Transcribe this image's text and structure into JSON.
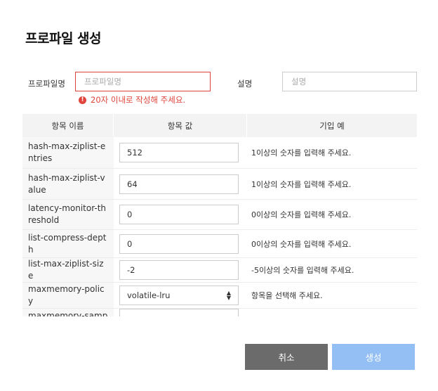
{
  "dialog": {
    "title": "프로파일 생성"
  },
  "form": {
    "name_label": "프로파일명",
    "name_placeholder": "프로파일명",
    "name_error": "20자 이내로 작성해 주세요.",
    "desc_label": "설명",
    "desc_placeholder": "설명"
  },
  "table": {
    "columns": [
      "항목 이름",
      "항목 값",
      "기입 예"
    ],
    "rows": [
      {
        "name": "hash-max-ziplist-entries",
        "value": "512",
        "hint": "1이상의 숫자를 입력해 주세요."
      },
      {
        "name": "hash-max-ziplist-value",
        "value": "64",
        "hint": "1이상의 숫자를 입력해 주세요."
      },
      {
        "name": "latency-monitor-threshold",
        "value": "0",
        "hint": "0이상의 숫자를 입력해 주세요."
      },
      {
        "name": "list-compress-depth",
        "value": "0",
        "hint": "0이상의 숫자를 입력해 주세요."
      },
      {
        "name": "list-max-ziplist-size",
        "value": "-2",
        "hint": "-5이상의 숫자를 입력해 주세요."
      },
      {
        "name": "maxmemory-policy",
        "value": "volatile-lru",
        "hint": "항목을 선택해 주세요."
      },
      {
        "name": "maxmemory-sampl",
        "value": "",
        "hint": ""
      }
    ]
  },
  "buttons": {
    "cancel": "취소",
    "create": "생성"
  },
  "colors": {
    "error": "#e0443a",
    "cancel_bg": "#6b6b6b",
    "create_bg": "#93bff5"
  }
}
